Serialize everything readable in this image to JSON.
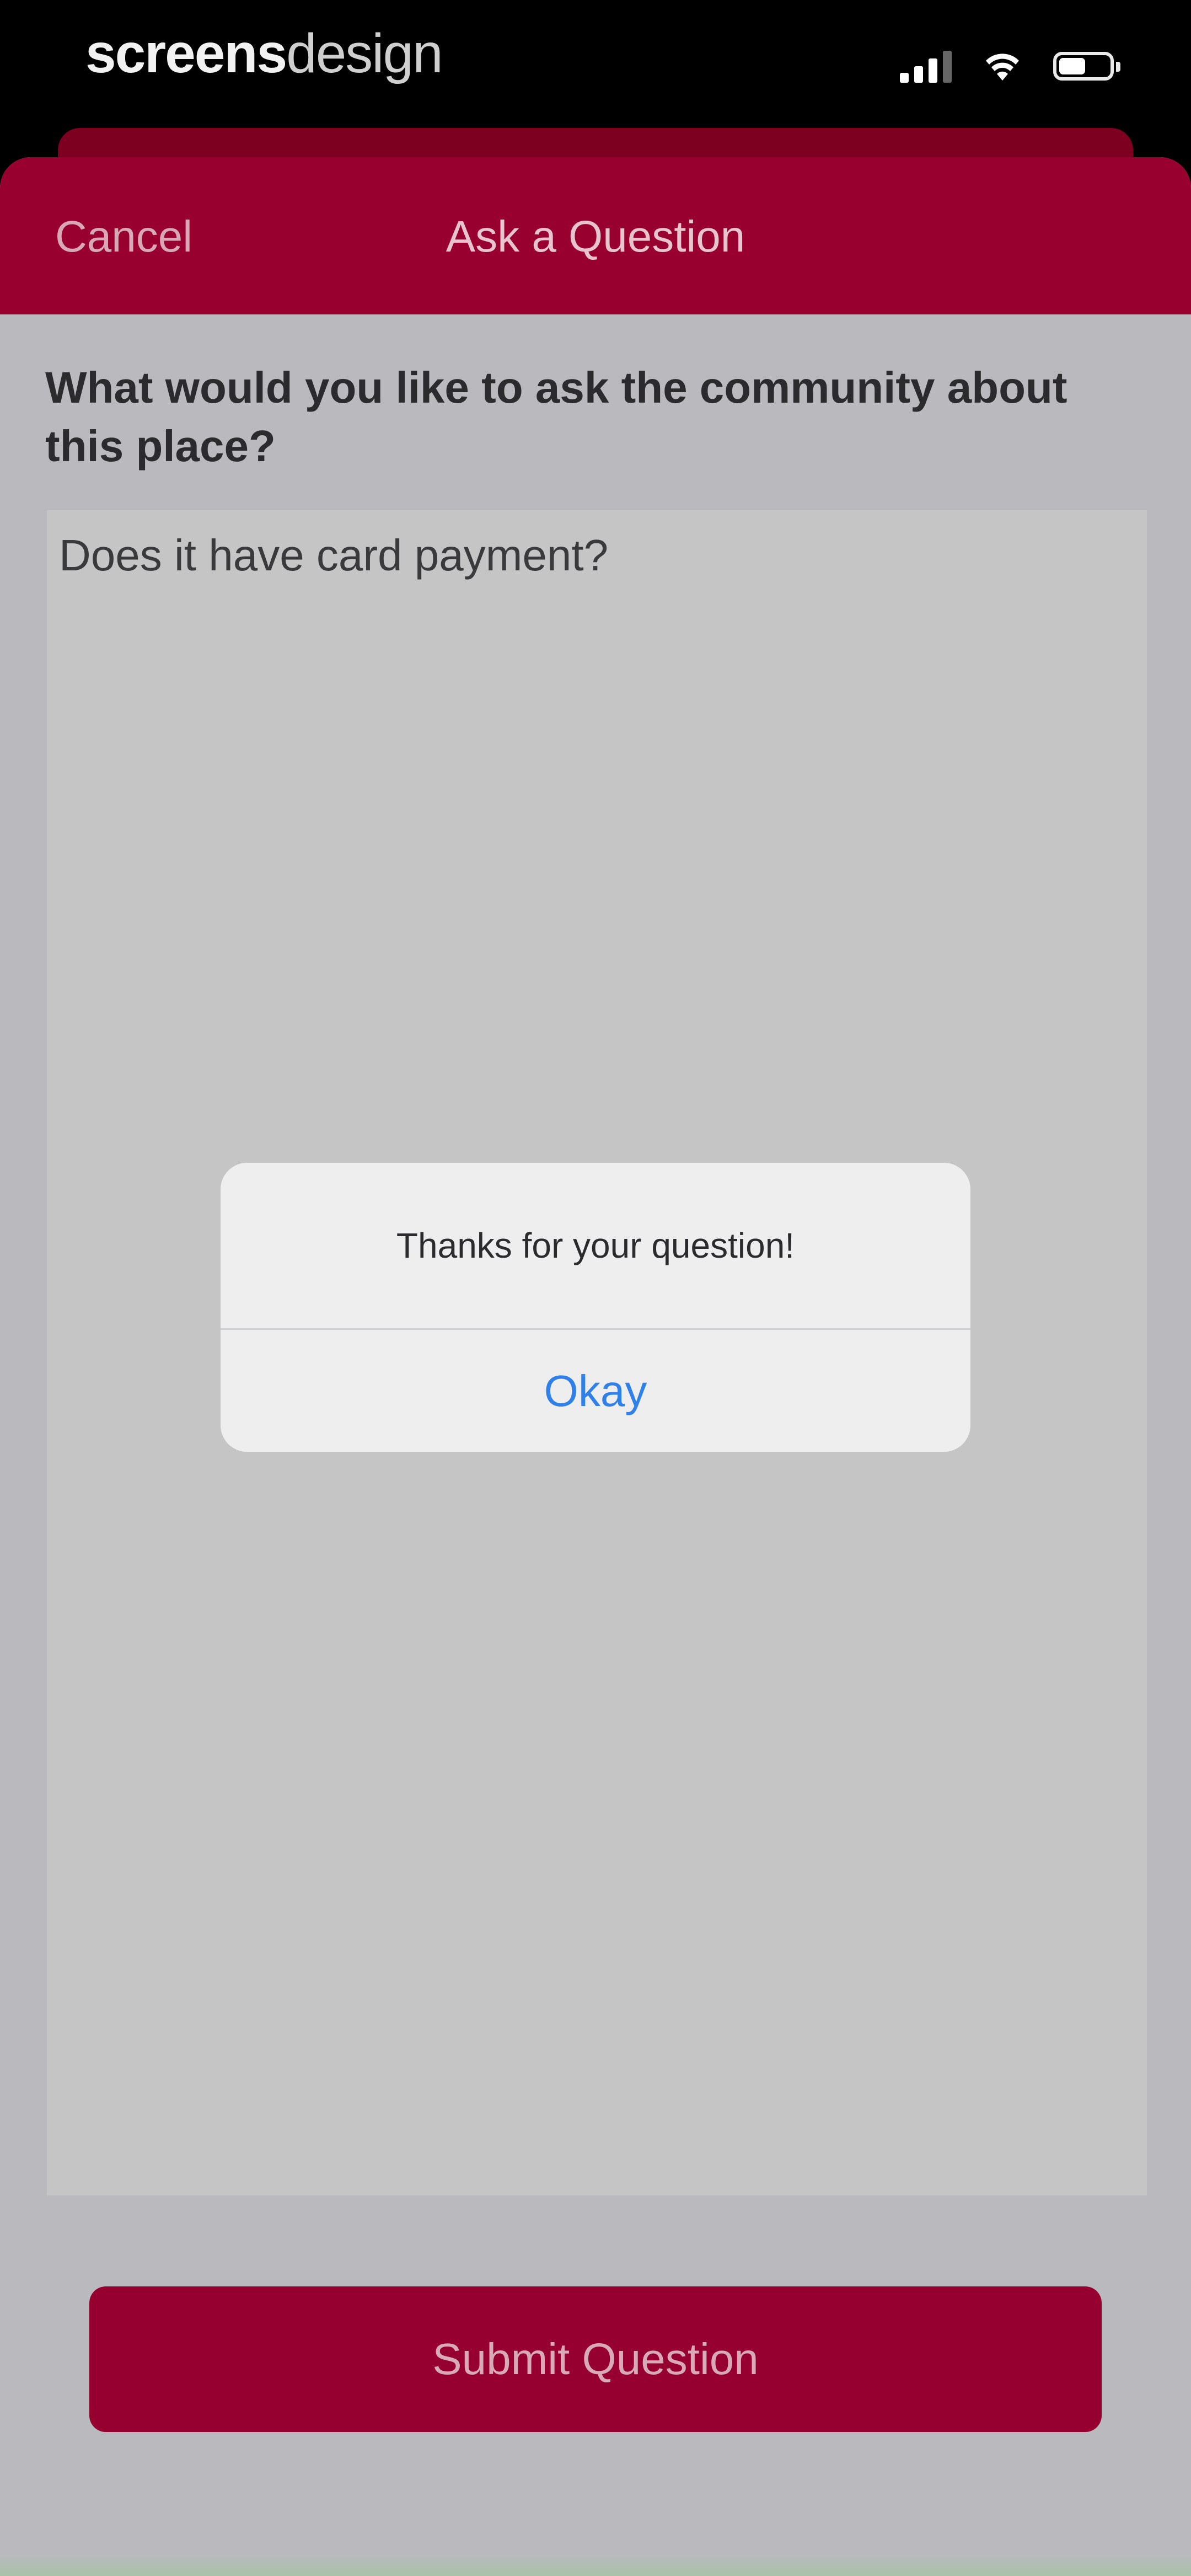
{
  "status_bar": {
    "brand_bold": "screens",
    "brand_light": "design",
    "battery_level": 0.62
  },
  "nav": {
    "cancel_label": "Cancel",
    "title": "Ask a Question"
  },
  "form": {
    "prompt": "What would you like to ask the community about this place?",
    "question_value": "Does it have card payment?",
    "submit_label": "Submit Question"
  },
  "alert": {
    "message": "Thanks for your question!",
    "okay_label": "Okay"
  },
  "colors": {
    "brand_red": "#980030",
    "alert_action_blue": "#2f80e8"
  }
}
